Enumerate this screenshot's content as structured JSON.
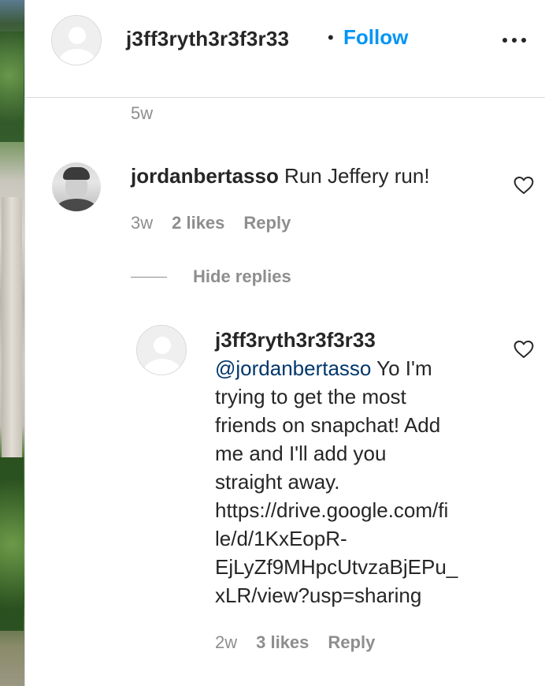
{
  "header": {
    "username": "j3ff3ryth3r3f3r33",
    "separator": "•",
    "follow_label": "Follow",
    "more_icon": "more-options-icon"
  },
  "caption": {
    "time": "5w"
  },
  "comments": [
    {
      "username": "jordanbertasso",
      "text": " Run Jeffery run!",
      "time": "3w",
      "likes": "2 likes",
      "reply_label": "Reply",
      "like_icon": "heart-icon"
    }
  ],
  "replies_toggle": {
    "label": "Hide replies"
  },
  "replies": [
    {
      "username": "j3ff3ryth3r3f3r33",
      "lines": [
        "Yo I'm",
        "trying to get the most",
        "friends on snapchat! Add",
        "me and I'll add you",
        "straight away.",
        "https://drive.google.com/fi",
        "le/d/1KxEopR-",
        "EjLyZf9MHpcUtvzaBjEPu_",
        "xLR/view?usp=sharing"
      ],
      "mention": "@jordanbertasso",
      "time": "2w",
      "likes": "3 likes",
      "reply_label": "Reply",
      "like_icon": "heart-icon"
    }
  ],
  "colors": {
    "link_blue": "#0095f6",
    "mention_blue": "#00376b",
    "secondary_text": "#8e8e8e",
    "primary_text": "#262626"
  }
}
